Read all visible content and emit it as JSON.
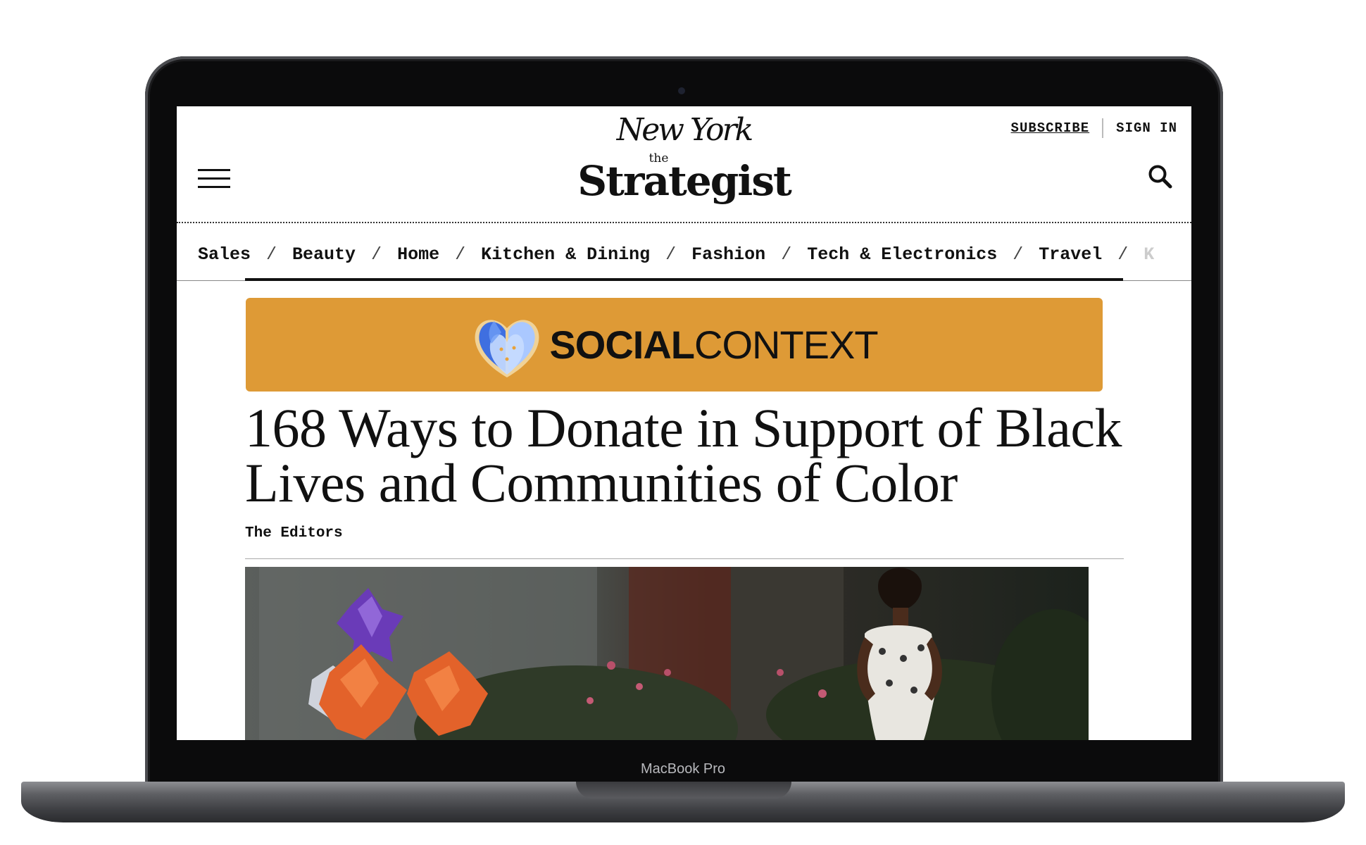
{
  "device": {
    "label": "MacBook Pro"
  },
  "header": {
    "nymag_logo": "New York",
    "the": "the",
    "title": "Strategist",
    "subscribe_label": "SUBSCRIBE",
    "signin_label": "SIGN IN"
  },
  "nav": {
    "items": [
      "Sales",
      "Beauty",
      "Home",
      "Kitchen & Dining",
      "Fashion",
      "Tech & Electronics",
      "Travel"
    ],
    "separator": "/"
  },
  "banner": {
    "bold": "SOCIAL",
    "light": "CONTEXT"
  },
  "article": {
    "headline": "168 Ways to Donate in Support of Black Lives and Communities of Color",
    "byline": "The Editors"
  },
  "colors": {
    "banner_bg": "#de9a36",
    "text": "#111111"
  },
  "icons": {
    "menu": "hamburger-icon",
    "search": "search-icon",
    "banner_logo": "social-context-logo-icon"
  }
}
